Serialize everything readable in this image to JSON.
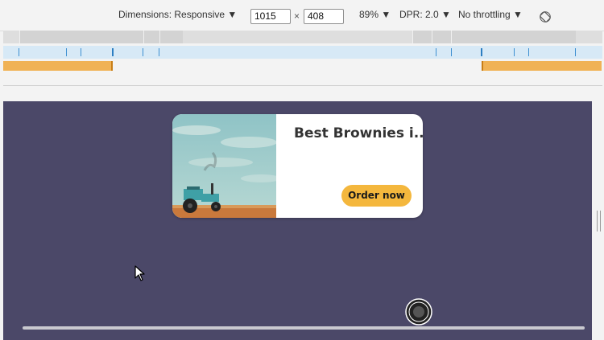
{
  "toolbar": {
    "dimensions_label": "Dimensions: Responsive ▼",
    "width_value": "1015",
    "times_symbol": "×",
    "height_value": "408",
    "zoom_label": "89% ▼",
    "dpr_label": "DPR: 2.0 ▼",
    "throttling_label": "No throttling ▼",
    "rotate_icon": "rotate-icon"
  },
  "card": {
    "title": "Best Brownies i...",
    "button_label": "Order now",
    "image_subject": "tractor-in-field",
    "button_color": "#f4b73d"
  },
  "viewport": {
    "background_color": "#4b4868"
  },
  "colors": {
    "media_query_blue": "#d7e9f6",
    "media_query_orange": "#f0b255"
  }
}
